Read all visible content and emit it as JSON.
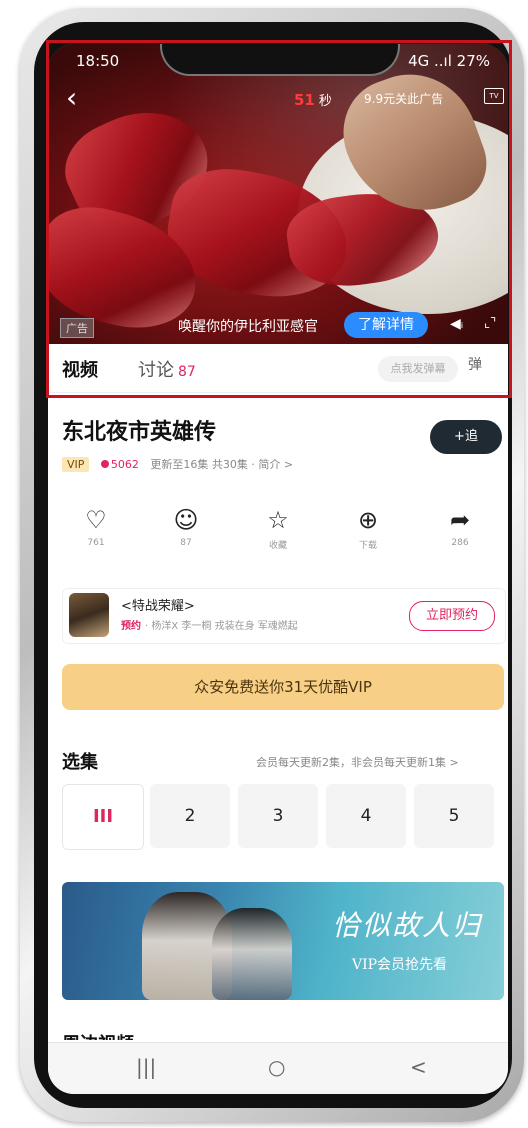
{
  "status": {
    "time": "18:50",
    "right": "4G ..ıl 27%"
  },
  "ad": {
    "countdown_num": "51",
    "countdown_unit": "秒",
    "close_ad": "9.9元关此广告",
    "tag": "广告",
    "slogan": "唤醒你的伊比利亚感官",
    "learn_more": "了解详情"
  },
  "tabs": {
    "video": "视频",
    "discuss": "讨论",
    "discuss_count": "87",
    "danmu_placeholder": "点我发弹幕",
    "danmu_toggle": "弹"
  },
  "show": {
    "title": "东北夜市英雄传",
    "follow": "+追",
    "vip": "VIP",
    "heat": "5062",
    "update": "更新至16集 共30集 · 简介 >"
  },
  "actions": [
    {
      "icon": "♡",
      "label": "761"
    },
    {
      "icon": "☺",
      "label": "87"
    },
    {
      "icon": "☆",
      "label": "收藏"
    },
    {
      "icon": "⊕",
      "label": "下载"
    },
    {
      "icon": "➦",
      "label": "286"
    }
  ],
  "booking": {
    "title": "<特战荣耀>",
    "tag": "预约",
    "desc": "· 杨洋X 李一桐 戎装在身 军魂燃起",
    "button": "立即预约"
  },
  "promo": "众安免费送你31天优酷VIP",
  "episodes": {
    "heading": "选集",
    "note": "会员每天更新2集，非会员每天更新1集 >",
    "items": [
      "III",
      "2",
      "3",
      "4",
      "5"
    ]
  },
  "banner": {
    "title": "恰似故人归",
    "subtitle": "VIP会员抢先看"
  },
  "peek": "周边视频",
  "nav": {
    "recents": "|||",
    "home": "○",
    "back": "<"
  },
  "colors": {
    "accent": "#e0245e",
    "promo_bg": "#f8cf86",
    "learn_btn": "#2b8cff",
    "highlight_box": "#c8121c"
  }
}
